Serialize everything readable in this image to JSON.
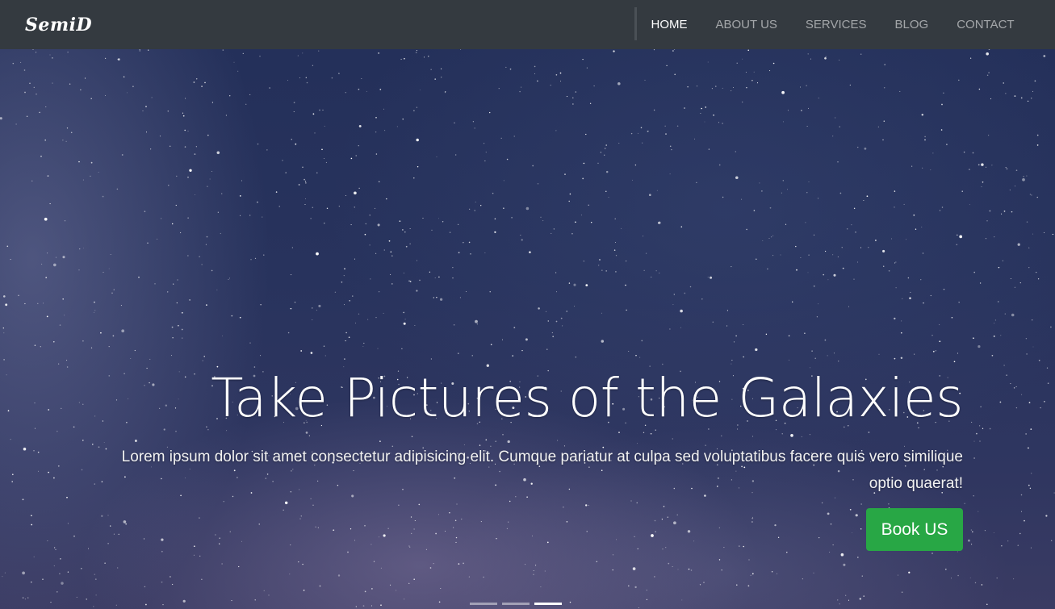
{
  "brand": {
    "name": "SemiD"
  },
  "nav": {
    "items": [
      {
        "label": "HOME",
        "active": true
      },
      {
        "label": "ABOUT US",
        "active": false
      },
      {
        "label": "SERVICES",
        "active": false
      },
      {
        "label": "BLOG",
        "active": false
      },
      {
        "label": "CONTACT",
        "active": false
      }
    ]
  },
  "hero": {
    "title": "Take Pictures of the Galaxies",
    "text": "Lorem ipsum dolor sit amet consectetur adipisicing elit. Cumque pariatur at culpa sed voluptatibus facere quis vero similique optio quaerat!",
    "button_label": "Book US",
    "carousel": {
      "slide_count": 3,
      "active_index": 2
    }
  },
  "colors": {
    "navbar": "#343a40",
    "button": "#28a745",
    "sky": "#24305a"
  }
}
